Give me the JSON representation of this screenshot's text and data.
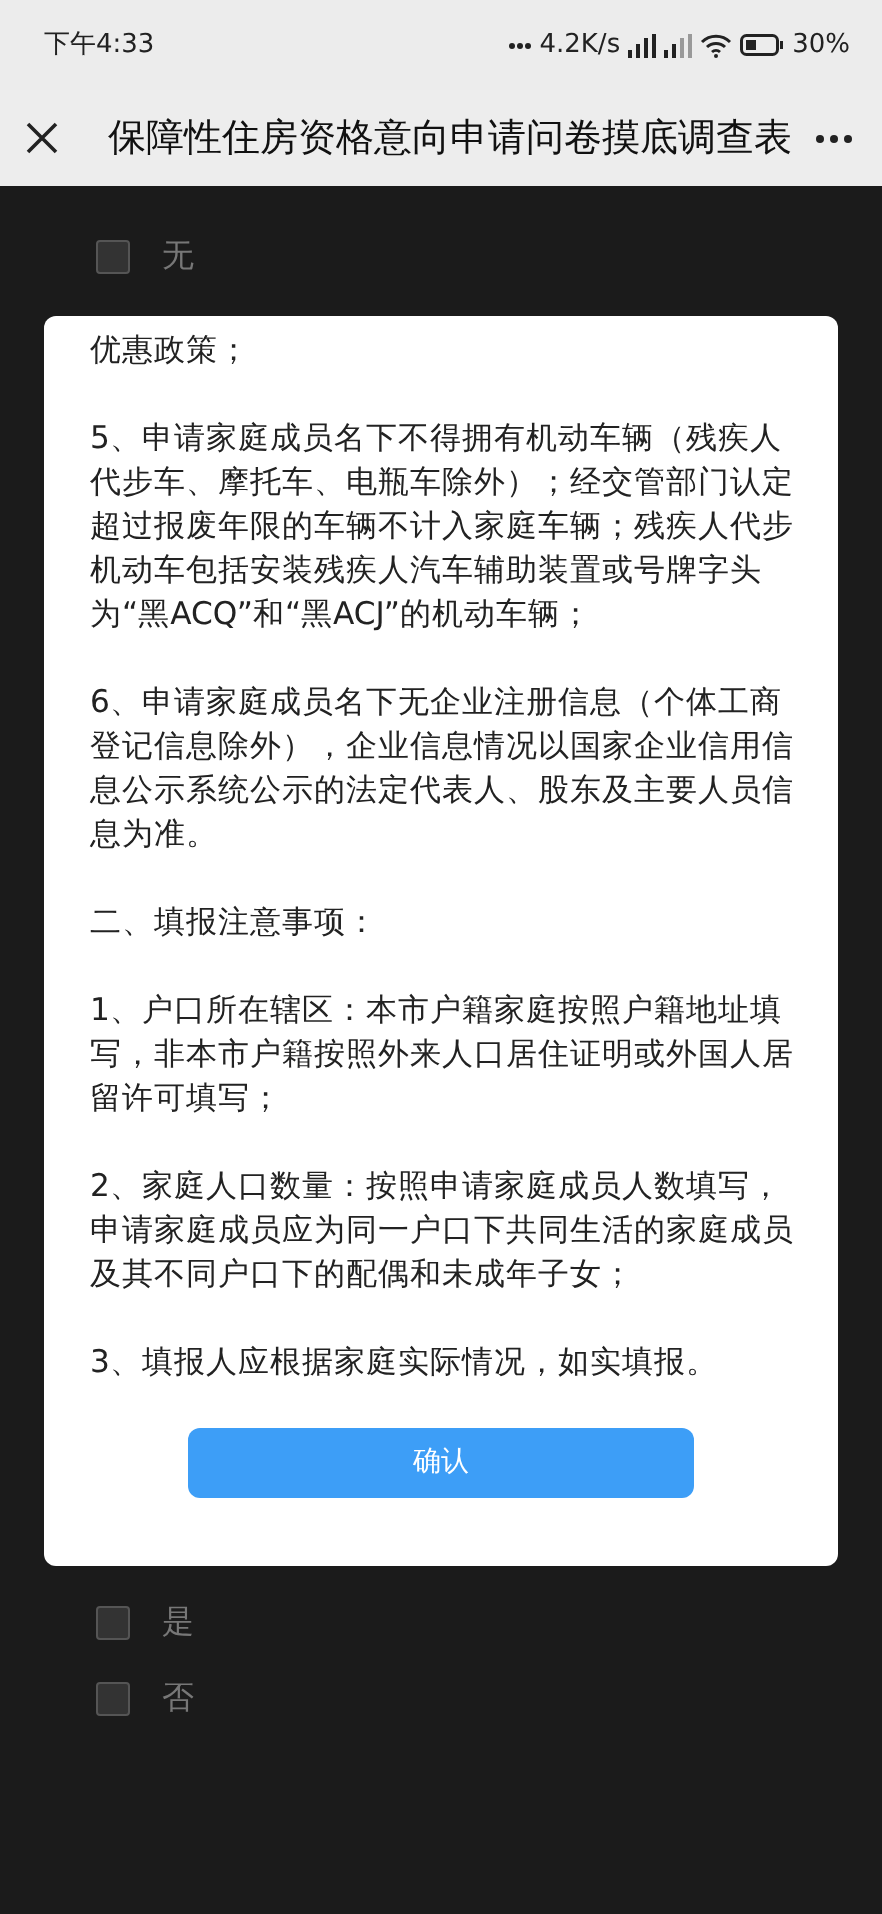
{
  "status_bar": {
    "time": "下午4:33",
    "net_speed": "4.2K/s",
    "battery": "30%"
  },
  "nav_bar": {
    "title": "保障性住房资格意向申请问卷摸底调查表"
  },
  "background_page": {
    "options_top": [
      {
        "label": "无",
        "checked": false
      }
    ],
    "options_bottom": [
      {
        "label": "是",
        "checked": false
      },
      {
        "label": "否",
        "checked": false
      }
    ]
  },
  "dialog": {
    "paragraphs": [
      "优惠政策；",
      "5、申请家庭成员名下不得拥有机动车辆（残疾人代步车、摩托车、电瓶车除外）；经交管部门认定超过报废年限的车辆不计入家庭车辆；残疾人代步机动车包括安装残疾人汽车辅助装置或号牌字头为“黑ACQ”和“黑ACJ”的机动车辆；",
      "6、申请家庭成员名下无企业注册信息（个体工商登记信息除外），企业信息情况以国家企业信用信息公示系统公示的法定代表人、股东及主要人员信息为准。",
      "二、填报注意事项：",
      "1、户口所在辖区：本市户籍家庭按照户籍地址填写，非本市户籍按照外来人口居住证明或外国人居留许可填写；",
      "2、家庭人口数量：按照申请家庭成员人数填写，申请家庭成员应为同一户口下共同生活的家庭成员及其不同户口下的配偶和未成年子女；",
      "3、填报人应根据家庭实际情况，如实填报。"
    ],
    "button": "确认"
  }
}
